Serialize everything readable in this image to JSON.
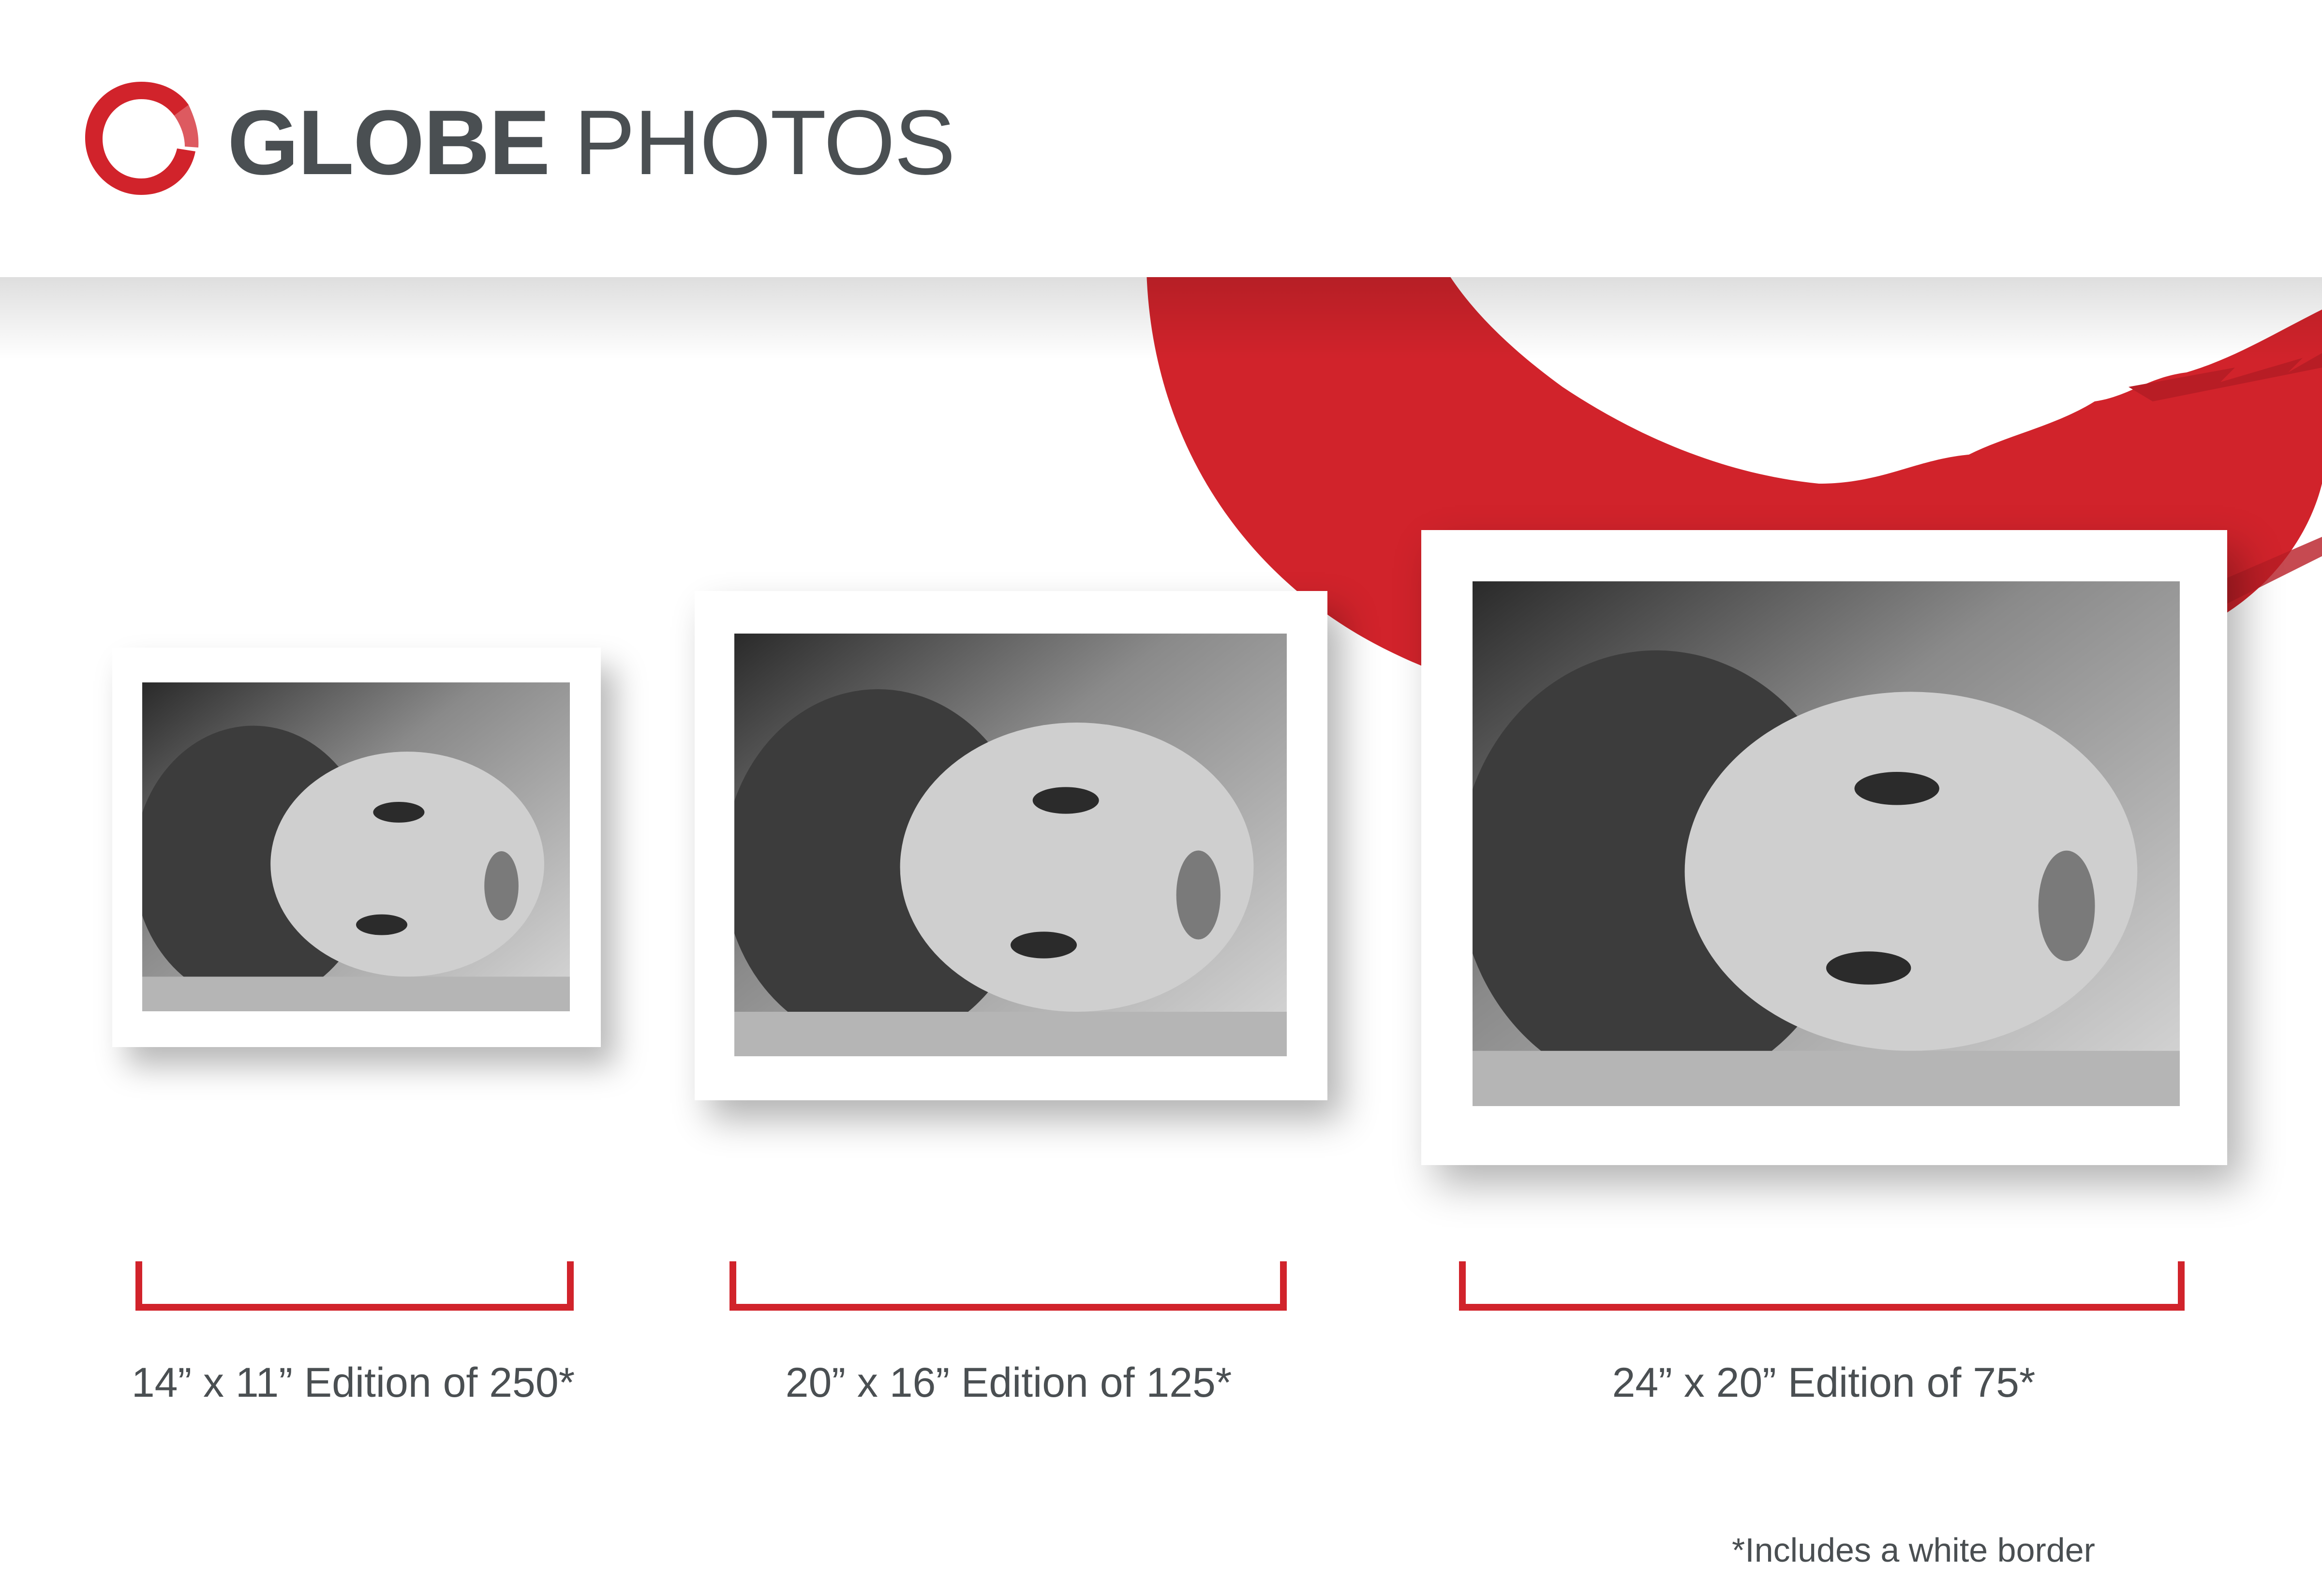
{
  "brand": {
    "name_bold": "GLOBE",
    "name_light": "PHOTOS",
    "logo_icon": "brush-ring-icon",
    "accent_color": "#d1232b",
    "text_color": "#4a4f52"
  },
  "prints": [
    {
      "size": "14” x 11”",
      "edition": "Edition of 250*",
      "caption": "14” x 11” Edition of 250*"
    },
    {
      "size": "20” x 16”",
      "edition": "Edition of 125*",
      "caption": "20” x 16” Edition of 125*"
    },
    {
      "size": "24” x 20”",
      "edition": "Edition of 75*",
      "caption": "24” x 20” Edition of 75*"
    }
  ],
  "footnote": "*Includes a white border"
}
